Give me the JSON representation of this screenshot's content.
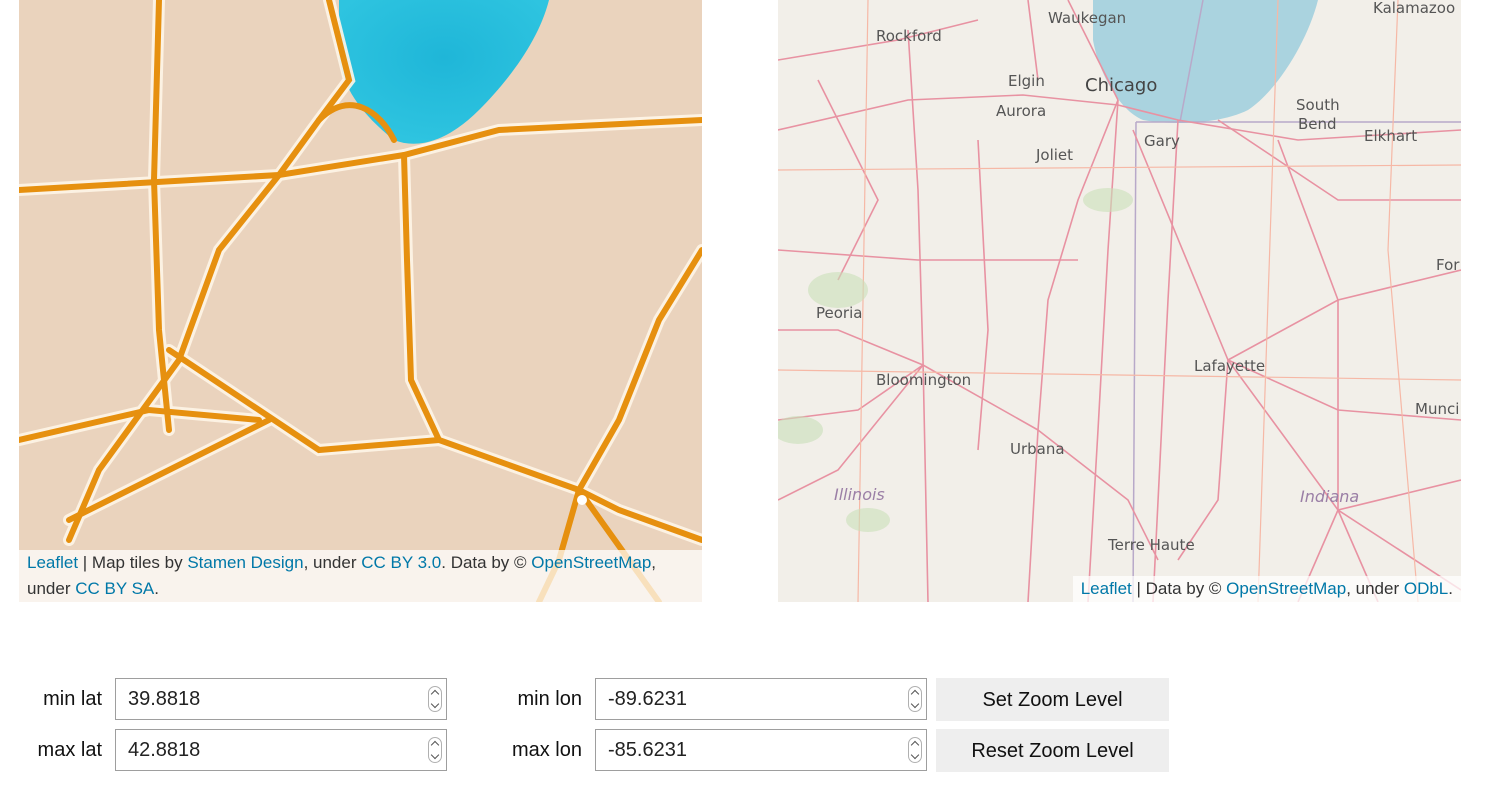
{
  "map_left": {
    "tiles": "watercolor",
    "attribution": {
      "leaflet": "Leaflet",
      "sep1": " | Map tiles by ",
      "stamen": "Stamen Design",
      "sep2": ", under ",
      "cc_by": "CC BY 3.0",
      "sep3": ". Data by © ",
      "osm": "OpenStreetMap",
      "sep4": ", under ",
      "cc_by_sa": "CC BY SA",
      "end": "."
    }
  },
  "map_right": {
    "tiles": "openstreetmap",
    "labels": {
      "waukegan": "Waukegan",
      "kalamazoo": "Kalamazoo",
      "rockford": "Rockford",
      "elgin": "Elgin",
      "chicago": "Chicago",
      "aurora": "Aurora",
      "south_bend_1": "South",
      "south_bend_2": "Bend",
      "elkhart": "Elkhart",
      "gary": "Gary",
      "joliet": "Joliet",
      "fort": "For",
      "peoria": "Peoria",
      "lafayette": "Lafayette",
      "bloomington": "Bloomington",
      "muncie": "Munci",
      "urbana": "Urbana",
      "illinois": "Illinois",
      "indiana": "Indiana",
      "terre_haute": "Terre Haute"
    },
    "attribution": {
      "leaflet": "Leaflet",
      "sep1": " | Data by © ",
      "osm": "OpenStreetMap",
      "sep2": ", under ",
      "odbl": "ODbL",
      "end": "."
    }
  },
  "controls": {
    "min_lat": {
      "label": "min lat",
      "value": "39.8818"
    },
    "max_lat": {
      "label": "max lat",
      "value": "42.8818"
    },
    "min_lon": {
      "label": "min lon",
      "value": "-89.6231"
    },
    "max_lon": {
      "label": "max lon",
      "value": "-85.6231"
    },
    "set_zoom": "Set Zoom Level",
    "reset_zoom": "Reset Zoom Level"
  }
}
